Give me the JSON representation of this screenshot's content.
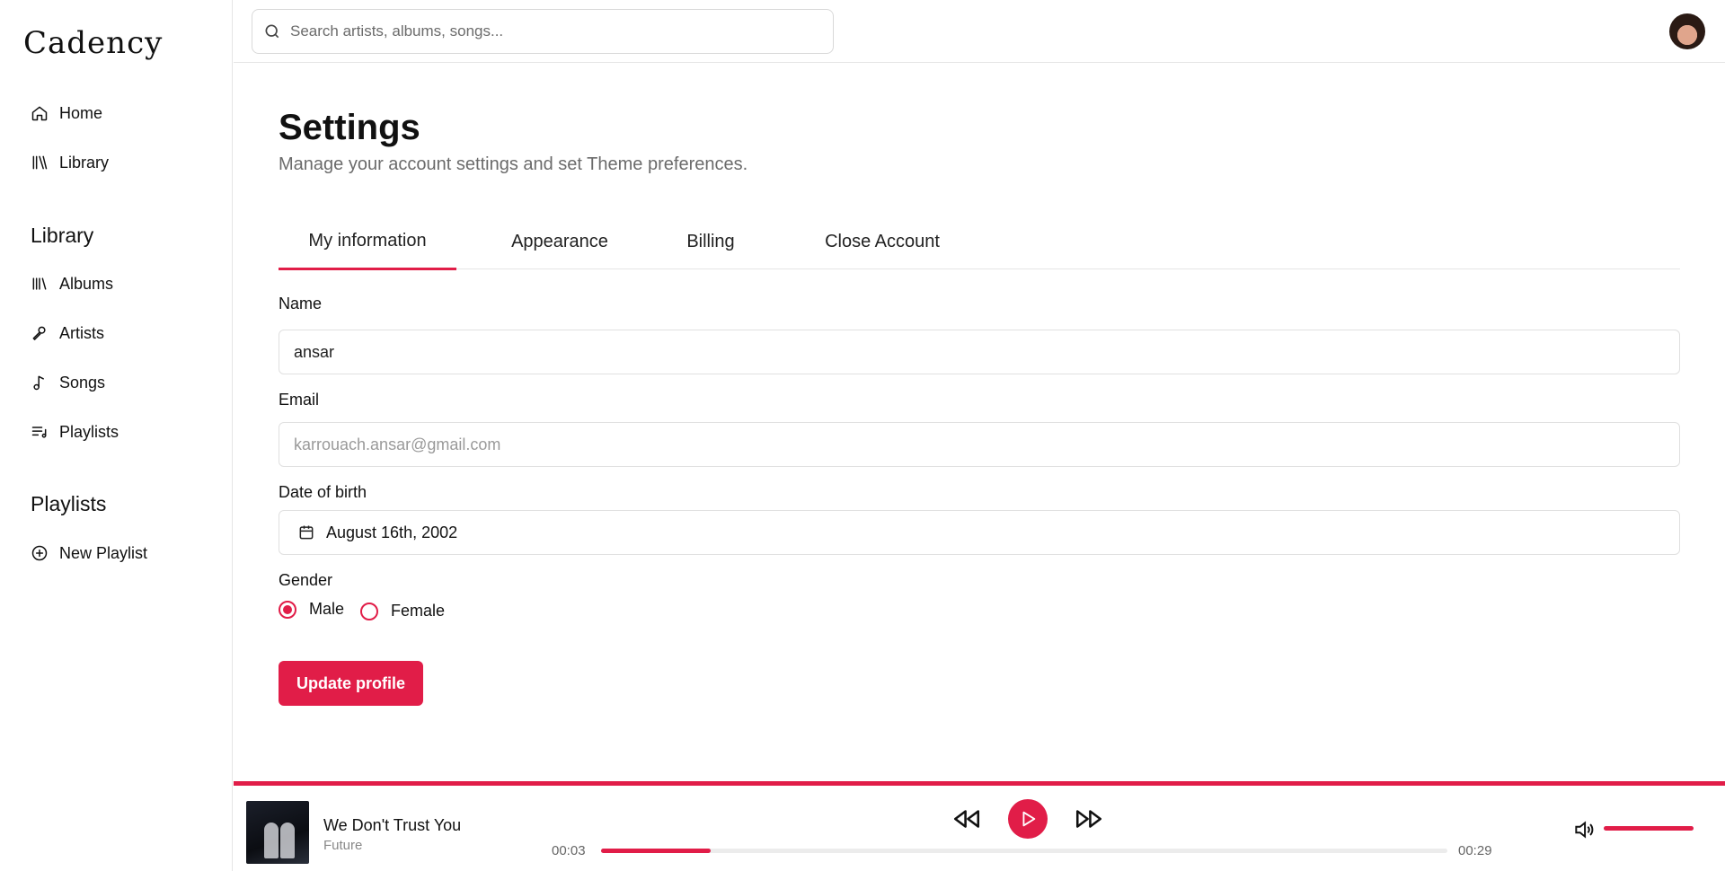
{
  "app": {
    "name": "Cadency"
  },
  "sidebar": {
    "nav": [
      {
        "label": "Home",
        "icon": "home-icon"
      },
      {
        "label": "Library",
        "icon": "library-icon"
      }
    ],
    "library_title": "Library",
    "library_items": [
      {
        "label": "Albums",
        "icon": "albums-icon"
      },
      {
        "label": "Artists",
        "icon": "microphone-icon"
      },
      {
        "label": "Songs",
        "icon": "music-note-icon"
      },
      {
        "label": "Playlists",
        "icon": "playlist-icon"
      }
    ],
    "playlists_title": "Playlists",
    "new_playlist": {
      "label": "New Playlist",
      "icon": "plus-circle-icon"
    }
  },
  "topbar": {
    "search_placeholder": "Search artists, albums, songs..."
  },
  "settings": {
    "title": "Settings",
    "subtitle": "Manage your account settings and set Theme preferences.",
    "tabs": [
      "My information",
      "Appearance",
      "Billing",
      "Close Account"
    ],
    "active_tab": "My information",
    "form": {
      "name_label": "Name",
      "name_value": "ansar",
      "email_label": "Email",
      "email_value": "karrouach.ansar@gmail.com",
      "dob_label": "Date of birth",
      "dob_value": "August 16th, 2002",
      "gender_label": "Gender",
      "gender_options": [
        "Male",
        "Female"
      ],
      "gender_selected": "Male",
      "submit_label": "Update profile"
    }
  },
  "player": {
    "track_title": "We Don't Trust You",
    "track_artist": "Future",
    "elapsed": "00:03",
    "duration": "00:29",
    "progress_fraction": 0.13,
    "volume_fraction": 1.0
  },
  "colors": {
    "accent": "#e11d48",
    "border": "#e5e5e5",
    "muted_text": "#6b6b6b"
  }
}
